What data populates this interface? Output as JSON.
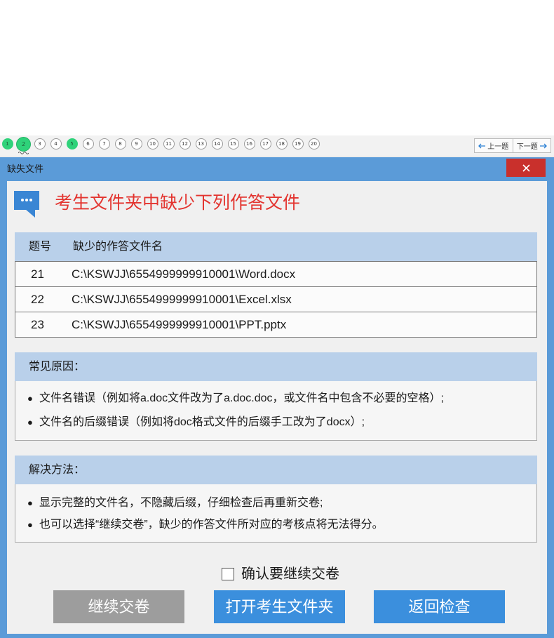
{
  "question_nav": {
    "items": [
      {
        "label": "1",
        "state": "answered"
      },
      {
        "label": "2",
        "state": "current"
      },
      {
        "label": "3",
        "state": "unanswered"
      },
      {
        "label": "4",
        "state": "unanswered"
      },
      {
        "label": "5",
        "state": "answered"
      },
      {
        "label": "6",
        "state": "unanswered"
      },
      {
        "label": "7",
        "state": "unanswered"
      },
      {
        "label": "8",
        "state": "unanswered"
      },
      {
        "label": "9",
        "state": "unanswered"
      },
      {
        "label": "10",
        "state": "unanswered"
      },
      {
        "label": "11",
        "state": "unanswered"
      },
      {
        "label": "12",
        "state": "unanswered"
      },
      {
        "label": "13",
        "state": "unanswered"
      },
      {
        "label": "14",
        "state": "unanswered"
      },
      {
        "label": "15",
        "state": "unanswered"
      },
      {
        "label": "16",
        "state": "unanswered"
      },
      {
        "label": "17",
        "state": "unanswered"
      },
      {
        "label": "18",
        "state": "unanswered"
      },
      {
        "label": "19",
        "state": "unanswered"
      },
      {
        "label": "20",
        "state": "unanswered"
      }
    ],
    "prev_label": "上一题",
    "next_label": "下一题"
  },
  "dialog": {
    "title": "缺失文件",
    "heading": "考生文件夹中缺少下列作答文件",
    "bullet": "●",
    "table": {
      "headers": [
        "题号",
        "缺少的作答文件名"
      ],
      "rows": [
        {
          "num": "21",
          "path": "C:\\KSWJJ\\6554999999910001\\Word.docx"
        },
        {
          "num": "22",
          "path": "C:\\KSWJJ\\6554999999910001\\Excel.xlsx"
        },
        {
          "num": "23",
          "path": "C:\\KSWJJ\\6554999999910001\\PPT.pptx"
        }
      ]
    },
    "reasons": {
      "title": "常见原因：",
      "items": [
        "文件名错误（例如将a.doc文件改为了a.doc.doc，或文件名中包含不必要的空格）;",
        "文件名的后缀错误（例如将doc格式文件的后缀手工改为了docx）;"
      ]
    },
    "solutions": {
      "title": "解决方法：",
      "items": [
        "显示完整的文件名，不隐藏后缀，仔细检查后再重新交卷;",
        "也可以选择“继续交卷”，缺少的作答文件所对应的考核点将无法得分。"
      ]
    },
    "confirm": {
      "label": "确认要继续交卷",
      "checked": false
    },
    "buttons": {
      "continue": "继续交卷",
      "open_folder": "打开考生文件夹",
      "back": "返回检查"
    }
  },
  "icons": {
    "heading": "message-bubble-icon",
    "close": "close-icon",
    "prev": "arrow-left-icon",
    "next": "arrow-right-icon",
    "current_marker": "squiggle-marker-icon"
  },
  "colors": {
    "frame": "#5b9bd8",
    "close_button": "#c9302c",
    "heading": "#e3342f",
    "answered": "#2fd27a",
    "table_header": "#b9d0ea",
    "button_gray": "#9d9d9d",
    "button_blue": "#3b8fdd",
    "icon_blue": "#3a86d4",
    "nav_arrow": "#2a7fd4"
  }
}
